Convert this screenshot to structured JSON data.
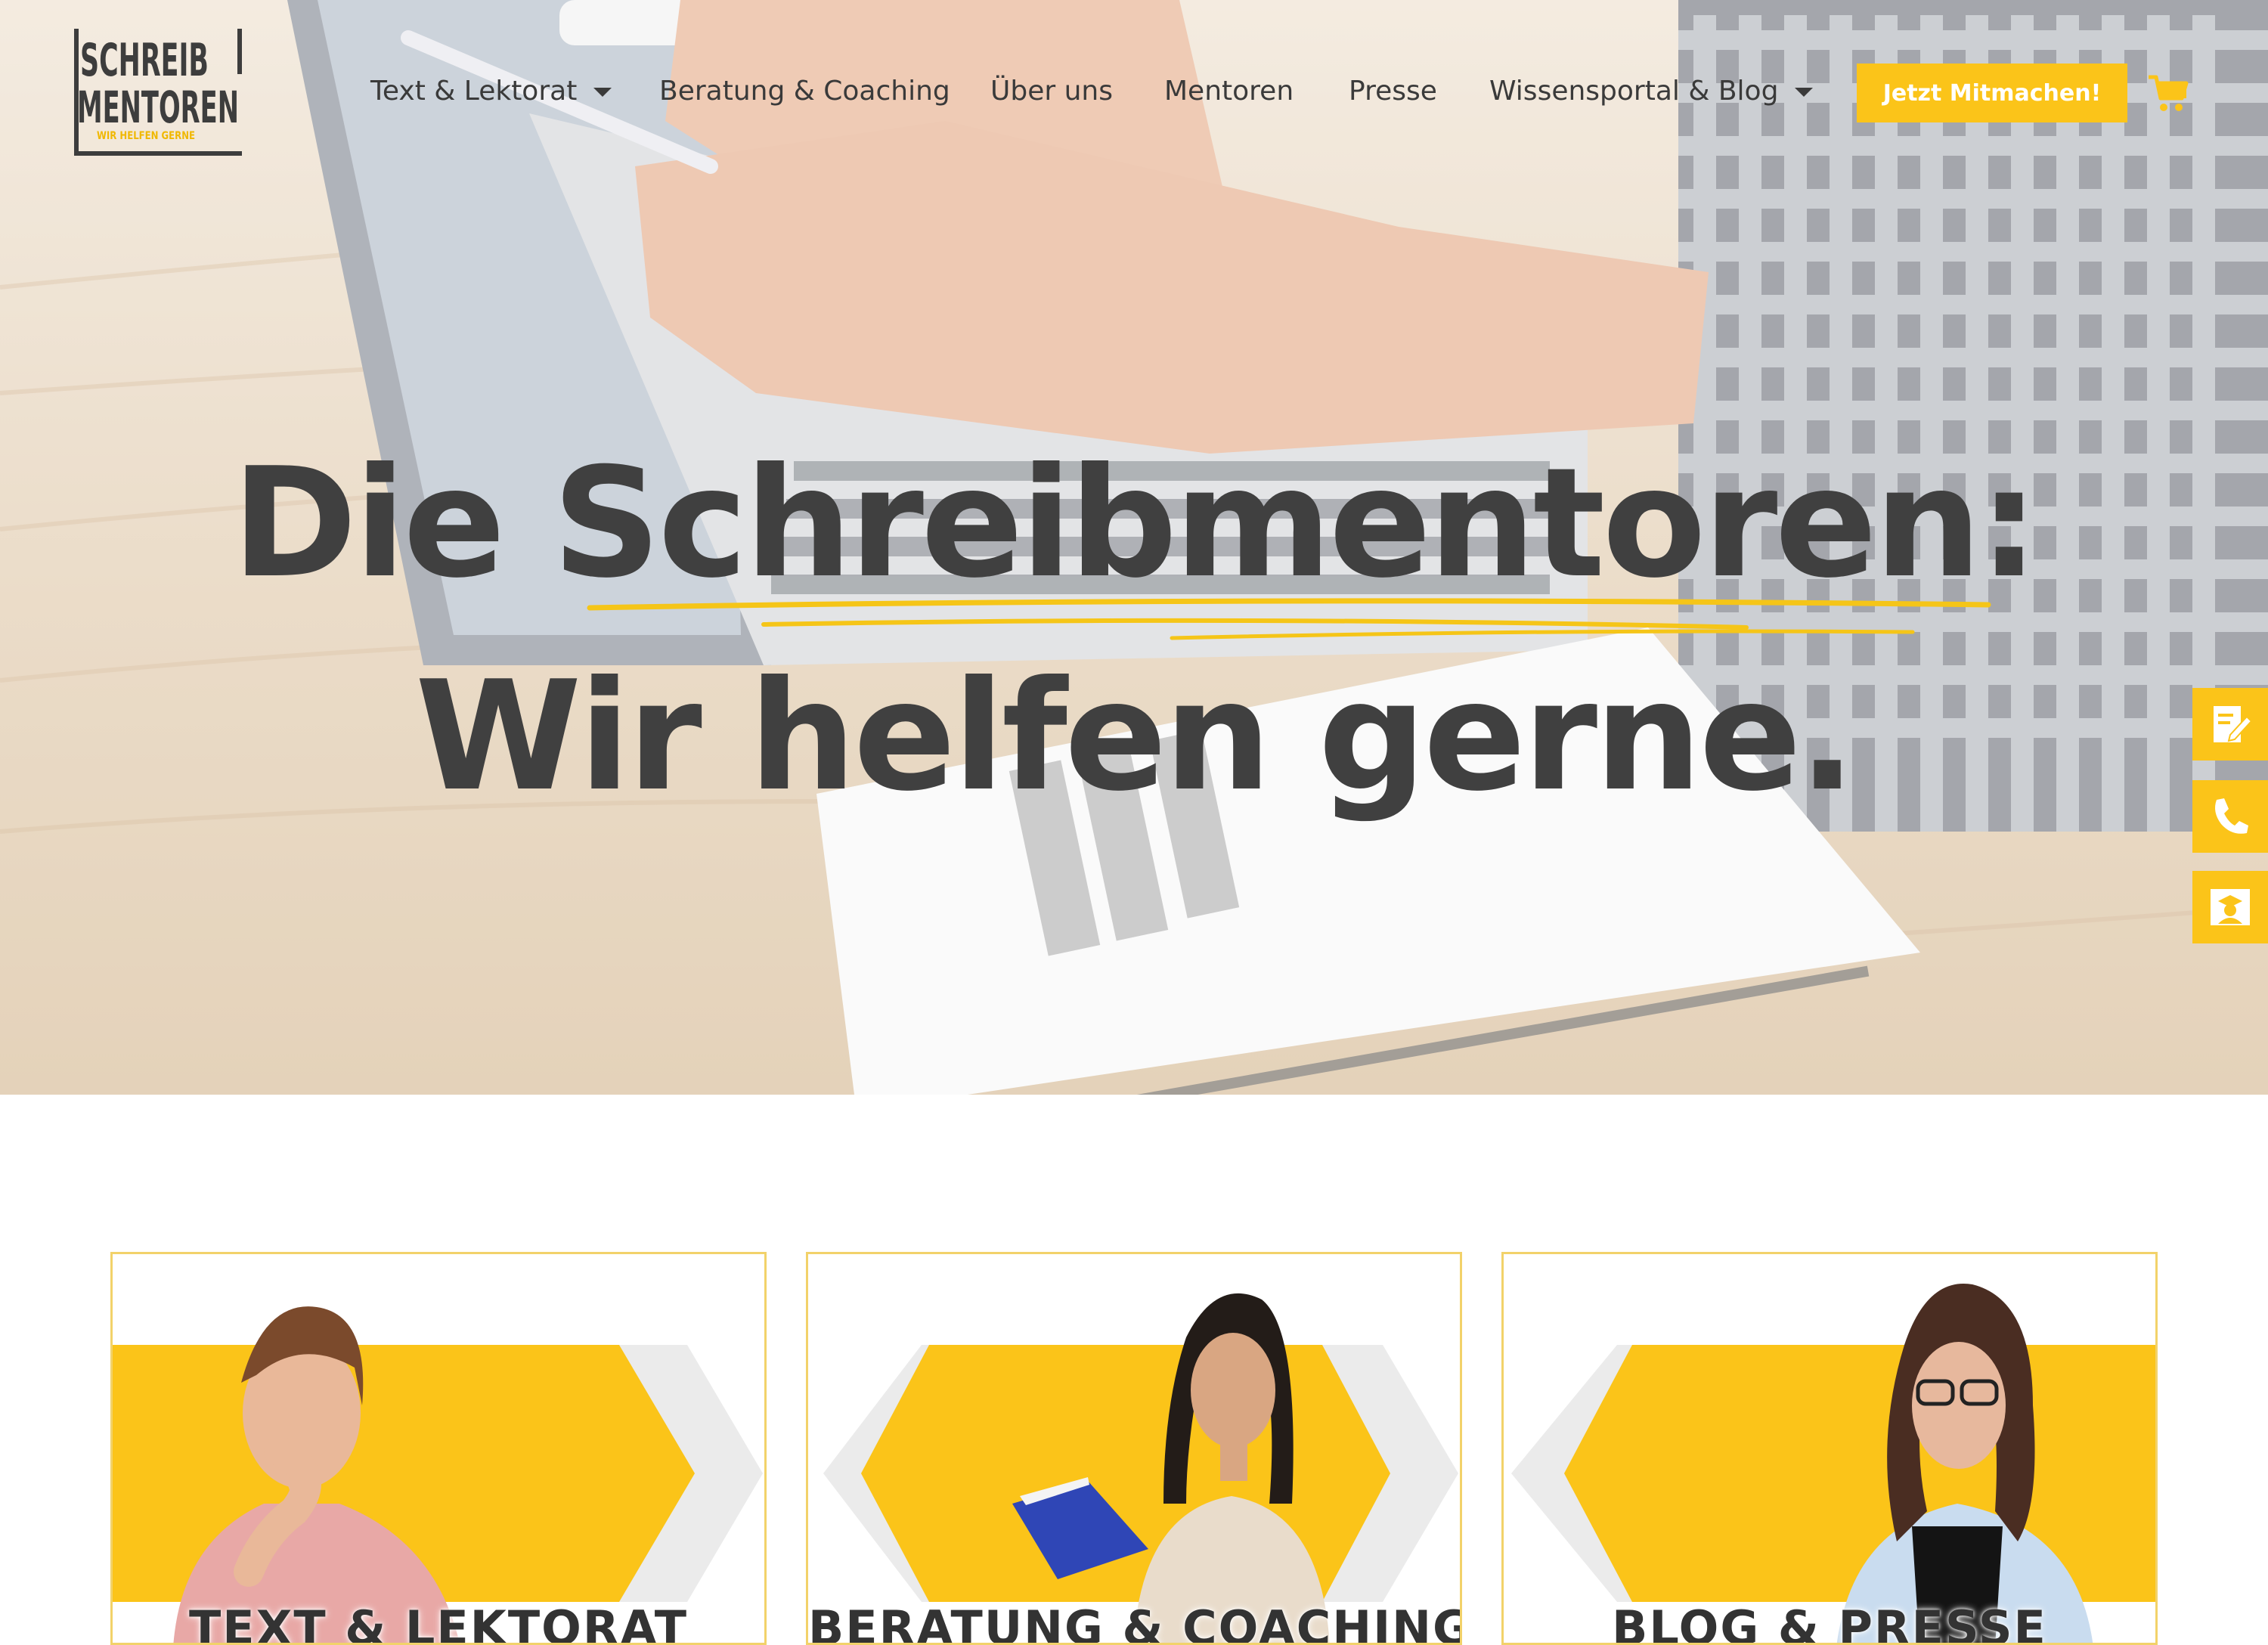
{
  "logo": {
    "line1": "SCHREIB",
    "line2": "MENTOREN",
    "tagline": "WIR HELFEN GERNE"
  },
  "nav": {
    "items": [
      {
        "label": "Text & Lektorat",
        "has_dropdown": true
      },
      {
        "label": "Beratung & Coaching",
        "has_dropdown": false
      },
      {
        "label": "Über uns",
        "has_dropdown": false
      },
      {
        "label": "Mentoren",
        "has_dropdown": false
      },
      {
        "label": "Presse",
        "has_dropdown": false
      },
      {
        "label": "Wissensportal & Blog",
        "has_dropdown": true
      }
    ],
    "cta_label": "Jetzt Mitmachen!",
    "cart_icon": "shopping-cart-icon"
  },
  "hero": {
    "line1": "Die Schreibmentoren:",
    "line2": "Wir helfen gerne."
  },
  "side_buttons": [
    {
      "icon": "document-edit-icon"
    },
    {
      "icon": "phone-icon"
    },
    {
      "icon": "graduate-icon"
    }
  ],
  "cards": [
    {
      "label": "TEXT & LEKTORAT"
    },
    {
      "label": "BERATUNG & COACHING"
    },
    {
      "label": "BLOG & PRESSE"
    }
  ],
  "colors": {
    "accent": "#fbc419",
    "text": "#404040",
    "card_border": "#f2d26a",
    "chevron_grey": "#ebebeb"
  }
}
